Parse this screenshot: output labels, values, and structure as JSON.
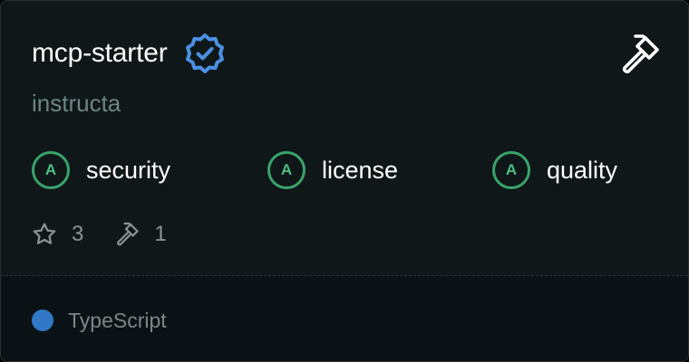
{
  "card": {
    "title": "mcp-starter",
    "owner": "instructa",
    "verified_icon": "verified-badge-icon",
    "tools_icon": "hammer-icon",
    "grades": [
      {
        "grade": "A",
        "label": "security"
      },
      {
        "grade": "A",
        "label": "license"
      },
      {
        "grade": "A",
        "label": "quality"
      }
    ],
    "stats": {
      "stars": "3",
      "tools": "1"
    },
    "language": {
      "name": "TypeScript",
      "color": "#3178c6"
    }
  },
  "colors": {
    "background": "#0f1719",
    "grade_accent": "#3aa36a",
    "verified_accent": "#4a90e2"
  }
}
